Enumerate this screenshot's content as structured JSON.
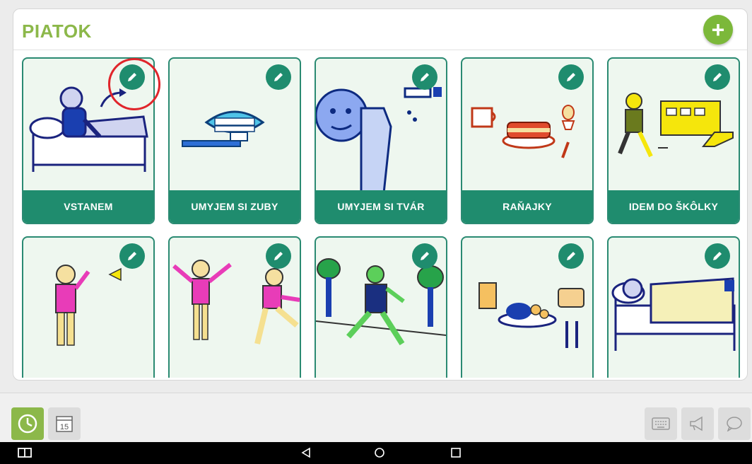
{
  "panel": {
    "title": "PIATOK",
    "add_button_label": "+"
  },
  "cards_row1": [
    {
      "label": "VSTANEM",
      "icon": "get-up-pictogram"
    },
    {
      "label": "UMYJEM SI ZUBY",
      "icon": "brush-teeth-pictogram"
    },
    {
      "label": "UMYJEM SI TVÁR",
      "icon": "wash-face-pictogram"
    },
    {
      "label": "RAŇAJKY",
      "icon": "breakfast-pictogram"
    },
    {
      "label": "IDEM DO ŠKÔLKY",
      "icon": "go-to-kindergarten-pictogram"
    }
  ],
  "cards_row2": [
    {
      "icon": "waving-child-pictogram"
    },
    {
      "icon": "exercise-pictogram"
    },
    {
      "icon": "walk-in-park-pictogram"
    },
    {
      "icon": "lunch-pictogram"
    },
    {
      "icon": "sleep-pictogram"
    }
  ],
  "toolbar": {
    "calendar_day": "15",
    "active_color": "#8cb84a"
  },
  "colors": {
    "brand_green": "#8cb84a",
    "card_teal": "#1f8c6e",
    "annotation_red": "#e0252b"
  }
}
